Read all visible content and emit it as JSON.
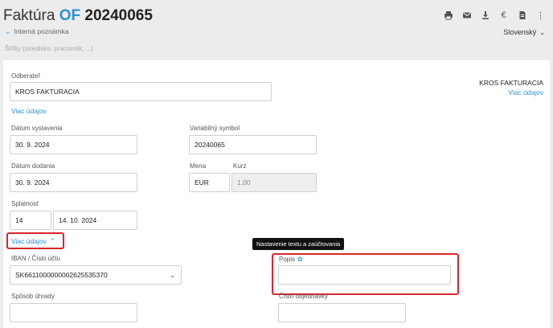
{
  "header": {
    "title_prefix": "Faktúra",
    "title_type": "OF",
    "title_number": "20240065",
    "internal_note_label": "Interná poznámka",
    "tags_placeholder": "Štítky (stredisko, pracovník, ...)",
    "language": "Slovenský",
    "toolbar_icons": [
      "print-icon",
      "mail-icon",
      "download-icon",
      "euro-icon",
      "document-icon",
      "more-vertical-icon"
    ]
  },
  "supplier": {
    "name": "KROS FAKTURACIA",
    "more_link": "Viac údajov"
  },
  "customer": {
    "label": "Odberateľ",
    "value": "KROS FAKTURACIA",
    "more_link": "Viac údajov"
  },
  "issue_date": {
    "label": "Dátum vystavenia",
    "value": "30. 9. 2024"
  },
  "variable_symbol": {
    "label": "Variabilný symbol",
    "value": "20240065"
  },
  "delivery_date": {
    "label": "Dátum dodania",
    "value": "30. 9. 2024"
  },
  "currency": {
    "label": "Mena",
    "value": "EUR"
  },
  "rate": {
    "label": "Kurz",
    "value": "1,00"
  },
  "due": {
    "label": "Splatnosť",
    "days": "14",
    "date": "14. 10. 2024"
  },
  "more_details_toggle": "Viac údajov",
  "iban": {
    "label": "IBAN / Číslo účtu",
    "value": "SK6611000000002625535370"
  },
  "description": {
    "label": "Popis",
    "value": "",
    "tooltip": "Nastavenie textu a zaúčtovania"
  },
  "payment_method": {
    "label": "Spôsob úhrady",
    "value": ""
  },
  "order_number": {
    "label": "Číslo objednávky",
    "value": ""
  },
  "colors": {
    "accent": "#2a8fd6",
    "highlight": "#d9262c"
  }
}
